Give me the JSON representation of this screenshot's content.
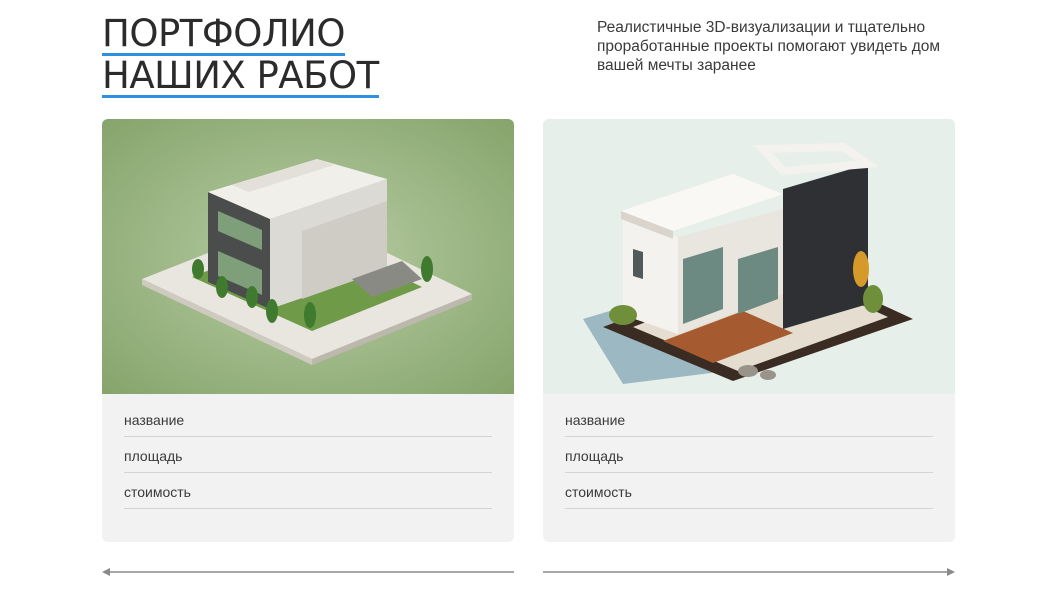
{
  "header": {
    "title_line1": "ПОРТФОЛИО",
    "title_line2": "НАШИХ РАБОТ",
    "subtitle": "Реалистичные 3D-визуализации и тщательно проработанные проекты помогают увидеть дом вашей мечты заранее"
  },
  "cards": [
    {
      "image": "modern-cube-house-render",
      "fields": [
        "название",
        "площадь",
        "стоимость"
      ]
    },
    {
      "image": "white-dark-house-with-deck-render",
      "fields": [
        "название",
        "площадь",
        "стоимость"
      ]
    }
  ],
  "navigation": {
    "prev_icon": "arrow-left-icon",
    "next_icon": "arrow-right-icon"
  },
  "colors": {
    "accent_underline": "#2f8fe0",
    "card_background": "#f2f2f2",
    "text": "#2b2b2b"
  }
}
